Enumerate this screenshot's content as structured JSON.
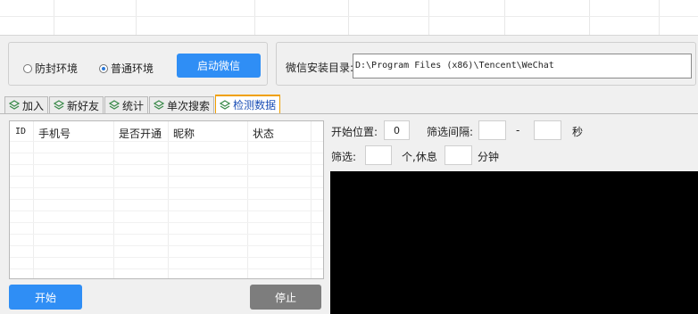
{
  "environment": {
    "option_safe": "防封环境",
    "option_normal": "普通环境",
    "selected": "普通环境",
    "start_button": "启动微信"
  },
  "install": {
    "label": "微信安装目录:",
    "path": "D:\\Program Files (x86)\\Tencent\\WeChat"
  },
  "tabs": [
    {
      "label": "加入",
      "icon": "layers-icon"
    },
    {
      "label": "新好友",
      "icon": "layers-icon"
    },
    {
      "label": "统计",
      "icon": "layers-icon"
    },
    {
      "label": "单次搜索",
      "icon": "layers-icon"
    },
    {
      "label": "检测数据",
      "icon": "layers-icon",
      "active": true
    }
  ],
  "table": {
    "columns": [
      "ID",
      "手机号",
      "是否开通",
      "昵称",
      "状态"
    ]
  },
  "buttons": {
    "start": "开始",
    "stop": "停止"
  },
  "settings": {
    "start_pos_label": "开始位置:",
    "start_pos_value": "0",
    "interval_label": "筛选间隔:",
    "interval_sep": "-",
    "interval_unit": "秒",
    "filter_label": "筛选:",
    "filter_unit": "个,休息",
    "rest_unit": "分钟"
  },
  "colors": {
    "accent": "#2f8ef5",
    "stop_button": "#7d7d7d",
    "active_tab_border": "#f0a000",
    "console_bg": "#000000"
  }
}
